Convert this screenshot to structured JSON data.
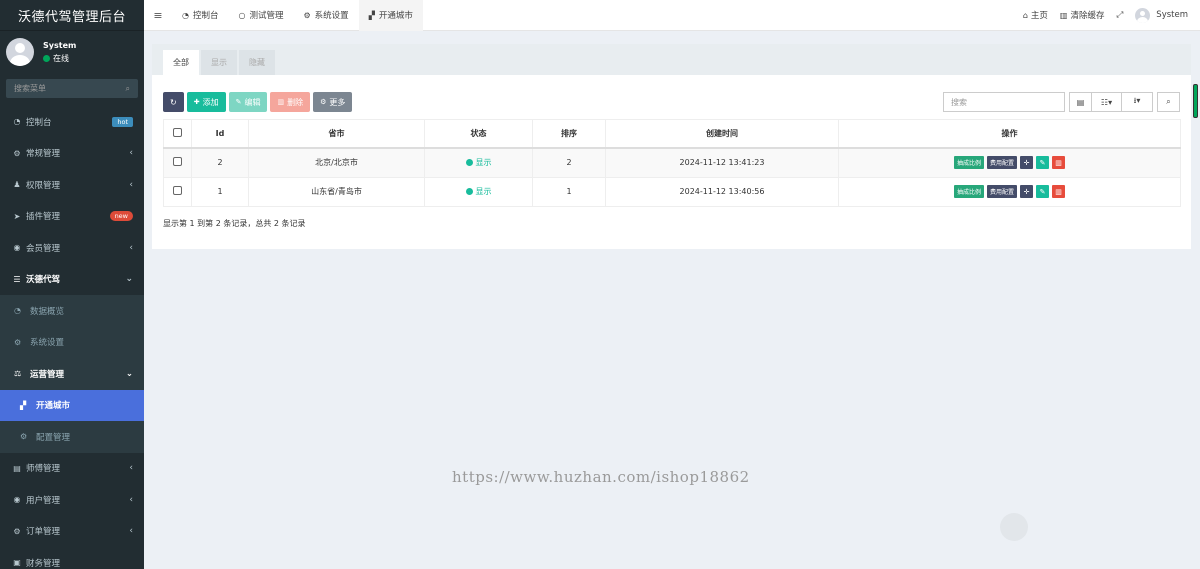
{
  "app": {
    "title": "沃德代驾管理后台"
  },
  "user": {
    "name": "System",
    "status": "在线"
  },
  "sidebar": {
    "search_placeholder": "搜索菜单",
    "items": [
      {
        "label": "控制台",
        "icon": "dashboard-icon",
        "badge": "hot"
      },
      {
        "label": "常规管理",
        "icon": "cogs-icon"
      },
      {
        "label": "权限管理",
        "icon": "group-icon"
      },
      {
        "label": "插件管理",
        "icon": "rocket-icon",
        "badge": "new"
      },
      {
        "label": "会员管理",
        "icon": "user-circle-icon"
      },
      {
        "label": "沃德代驾",
        "icon": "list-icon"
      },
      {
        "label": "数据概览",
        "icon": "dashboard-icon"
      },
      {
        "label": "系统设置",
        "icon": "gear-icon"
      },
      {
        "label": "运营管理",
        "icon": "balance-icon"
      },
      {
        "label": "开通城市",
        "icon": "checker-icon"
      },
      {
        "label": "配置管理",
        "icon": "cogs-icon"
      },
      {
        "label": "师傅管理",
        "icon": "id-card-icon"
      },
      {
        "label": "用户管理",
        "icon": "user-circle-icon"
      },
      {
        "label": "订单管理",
        "icon": "gear-icon"
      },
      {
        "label": "财务管理",
        "icon": "money-icon"
      }
    ]
  },
  "navbar": {
    "tabs": [
      {
        "label": "控制台",
        "icon": "dashboard-icon"
      },
      {
        "label": "测试管理",
        "icon": "circle-icon"
      },
      {
        "label": "系统设置",
        "icon": "gear-icon"
      },
      {
        "label": "开通城市",
        "icon": "checker-icon"
      }
    ],
    "home": "主页",
    "clear_cache": "清除缓存",
    "user": "System"
  },
  "panel": {
    "tabs": [
      "全部",
      "显示",
      "隐藏"
    ],
    "toolbar": {
      "add": "添加",
      "edit": "编辑",
      "delete": "删除",
      "more": "更多",
      "search_placeholder": "搜索"
    },
    "table": {
      "headers": [
        "Id",
        "省市",
        "状态",
        "排序",
        "创建时间",
        "操作"
      ],
      "rows": [
        {
          "id": "2",
          "city": "北京/北京市",
          "status": "显示",
          "sort": "2",
          "created": "2024-11-12 13:41:23"
        },
        {
          "id": "1",
          "city": "山东省/青岛市",
          "status": "显示",
          "sort": "1",
          "created": "2024-11-12 13:40:56"
        }
      ],
      "op_ratio": "抽成比例",
      "op_fee": "费用配置"
    },
    "footer": "显示第 1 到第 2 条记录，总共 2 条记录"
  },
  "watermark": "https://www.huzhan.com/ishop18862"
}
